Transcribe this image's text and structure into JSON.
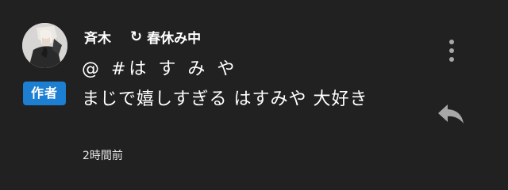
{
  "comment": {
    "author_name": "斉木",
    "reply_icon": "↻",
    "reply_to": "春休み中",
    "line1": "@  #は す み や",
    "line2": "まじで嬉しすぎる  はすみや 大好き",
    "timestamp": "2時間前",
    "author_badge": "作者",
    "badge_color": "#1c7fd1",
    "avatar_icon": "user-avatar-photo"
  },
  "actions": {
    "more_icon": "vertical-dots-icon",
    "reply_icon": "reply-arrow-icon"
  },
  "colors": {
    "background": "#212121",
    "text": "#ffffff",
    "icon": "#a8a8a8"
  }
}
